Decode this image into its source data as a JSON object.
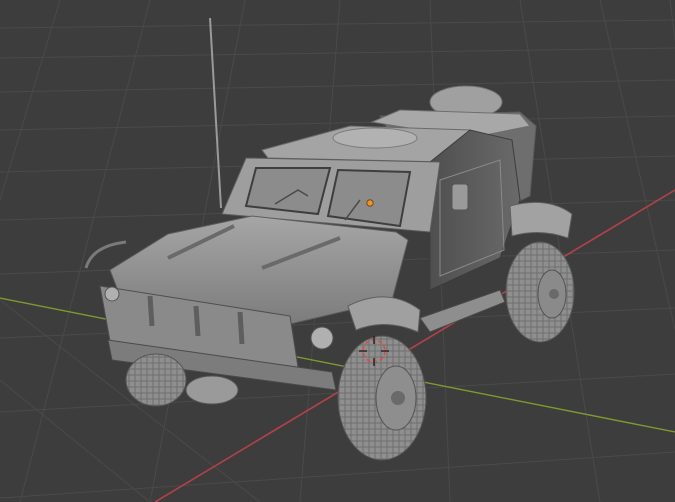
{
  "viewport": {
    "background": "#3d3d3d",
    "grid_line_color": "#4a4a4a",
    "axis_x_color": "#b8404a",
    "axis_y_color": "#7e9a30",
    "model_base_color": "#8d8d8d",
    "model_shadow_color": "#5a5a5a",
    "model_highlight_color": "#b2b2b2",
    "origin_marker_color": "#e8952a",
    "cursor_3d_color": "#e04848",
    "visible_objects": [
      "armored-vehicle-model",
      "3d-cursor",
      "object-origin",
      "floor-grid"
    ]
  }
}
